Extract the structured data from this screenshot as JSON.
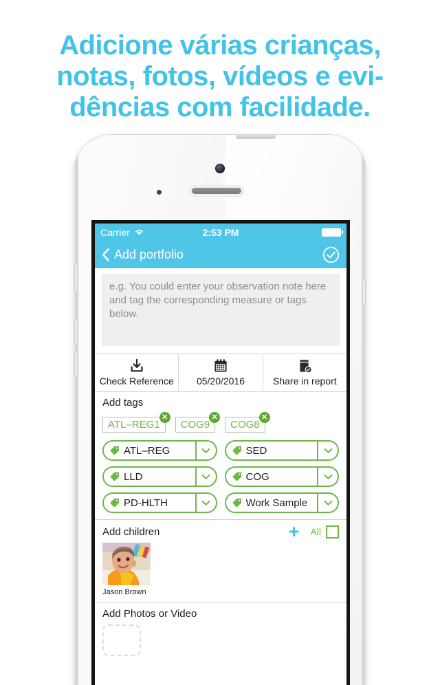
{
  "headline": {
    "lines": [
      "Adicione várias crianças,",
      "notas, fotos, vídeos e evi-",
      "dências com facilidade."
    ],
    "color": "#41c3e8"
  },
  "status_bar": {
    "carrier": "Carrier",
    "wifi_icon": "wifi-icon",
    "time": "2:53 PM",
    "battery_icon": "battery-full-icon"
  },
  "nav_bar": {
    "back_icon": "chevron-left-icon",
    "title": "Add portfolio",
    "done_icon": "check-circle-icon",
    "background": "#4fc6e8"
  },
  "note": {
    "value": "",
    "placeholder": "e.g. You could enter your observation note here and tag the corresponding measure or tags below."
  },
  "toolbar": {
    "items": [
      {
        "icon": "download-tray-icon",
        "label": "Check Reference"
      },
      {
        "icon": "calendar-icon",
        "label": "05/20/2016"
      },
      {
        "icon": "book-check-icon",
        "label": "Share in report"
      }
    ]
  },
  "tags_section": {
    "title": "Add tags",
    "chips": [
      {
        "label": "ATL–REG1",
        "remove_icon": "close-circle-icon"
      },
      {
        "label": "COG9",
        "remove_icon": "close-circle-icon"
      },
      {
        "label": "COG8",
        "remove_icon": "close-circle-icon"
      }
    ],
    "dropdowns": [
      {
        "icon": "tag-icon",
        "label": "ATL–REG",
        "caret": "chevron-down-icon"
      },
      {
        "icon": "tag-icon",
        "label": "SED",
        "caret": "chevron-down-icon"
      },
      {
        "icon": "tag-icon",
        "label": "LLD",
        "caret": "chevron-down-icon"
      },
      {
        "icon": "tag-icon",
        "label": "COG",
        "caret": "chevron-down-icon"
      },
      {
        "icon": "tag-icon",
        "label": "PD-HLTH",
        "caret": "chevron-down-icon"
      },
      {
        "icon": "tag-icon",
        "label": "Work Sample",
        "caret": "chevron-down-icon"
      }
    ],
    "chip_text_color": "#6fb845",
    "accent_green": "#6cb847"
  },
  "children_section": {
    "title": "Add children",
    "add_icon": "plus-icon",
    "all_label": "All",
    "all_checked": false,
    "children": [
      {
        "name": "Jason Brown"
      }
    ]
  },
  "photos_section": {
    "title": "Add Photos or Video",
    "add_slot_icon": "add-photo-placeholder"
  }
}
